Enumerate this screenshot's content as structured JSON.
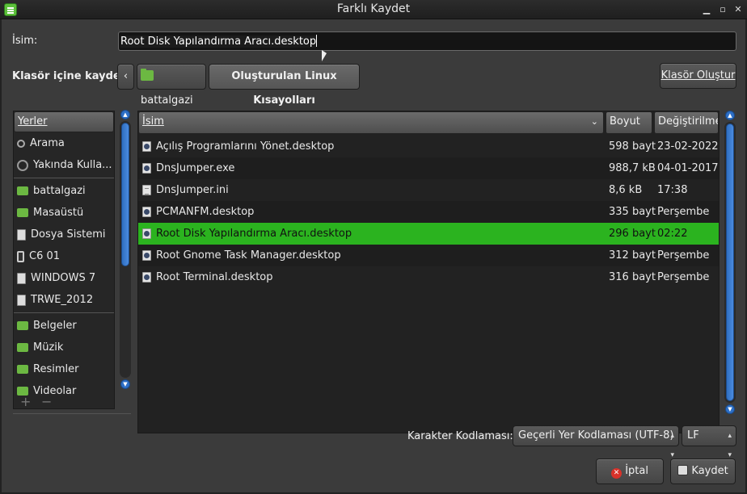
{
  "window": {
    "title": "Farklı Kaydet"
  },
  "name_row": {
    "label": "İsim:",
    "value": "Root Disk Yapılandırma Aracı.desktop"
  },
  "folder_row": {
    "label": "Klasör içine kaydet:",
    "back_glyph": "‹",
    "crumbs": [
      "battalgazi",
      "Oluşturulan Linux Kısayolları"
    ],
    "create_folder": "Klasör Oluştur"
  },
  "places": {
    "header": "Yerler",
    "items": [
      {
        "label": "Arama",
        "icon": "search-icon"
      },
      {
        "label": "Yakında Kulla...",
        "icon": "clock-icon"
      },
      {
        "label": "battalgazi",
        "icon": "home-folder-icon"
      },
      {
        "label": "Masaüstü",
        "icon": "desktop-folder-icon"
      },
      {
        "label": "Dosya Sistemi",
        "icon": "drive-icon"
      },
      {
        "label": "C6 01",
        "icon": "phone-icon"
      },
      {
        "label": "WINDOWS 7",
        "icon": "drive-icon"
      },
      {
        "label": "TRWE_2012",
        "icon": "drive-icon"
      },
      {
        "label": "Belgeler",
        "icon": "folder-icon"
      },
      {
        "label": "Müzik",
        "icon": "music-folder-icon"
      },
      {
        "label": "Resimler",
        "icon": "pictures-folder-icon"
      },
      {
        "label": "Videolar",
        "icon": "folder-icon"
      }
    ],
    "add_glyph": "+",
    "remove_glyph": "−"
  },
  "files": {
    "columns": {
      "name": "İsim",
      "size": "Boyut",
      "modified": "Değiştirilme"
    },
    "rows": [
      {
        "name": "Açılış Programlarını Yönet.desktop",
        "size": "598 bayt",
        "modified": "23-02-2022",
        "icon": "desktop-file-icon"
      },
      {
        "name": "DnsJumper.exe",
        "size": "988,7 kB",
        "modified": "04-01-2017",
        "icon": "executable-icon"
      },
      {
        "name": "DnsJumper.ini",
        "size": "8,6 kB",
        "modified": "17:38",
        "icon": "text-file-icon"
      },
      {
        "name": "PCMANFM.desktop",
        "size": "335 bayt",
        "modified": "Perşembe",
        "icon": "desktop-file-icon"
      },
      {
        "name": "Root Disk Yapılandırma Aracı.desktop",
        "size": "296 bayt",
        "modified": "02:22",
        "icon": "desktop-file-icon",
        "selected": true
      },
      {
        "name": "Root Gnome Task Manager.desktop",
        "size": "312 bayt",
        "modified": "Perşembe",
        "icon": "desktop-file-icon"
      },
      {
        "name": "Root Terminal.desktop",
        "size": "316 bayt",
        "modified": "Perşembe",
        "icon": "desktop-file-icon"
      }
    ]
  },
  "encoding": {
    "label": "Karakter Kodlaması:",
    "value": "Geçerli Yer Kodlaması (UTF-8)",
    "line_ending": "LF"
  },
  "actions": {
    "cancel": "İptal",
    "save": "Kaydet"
  },
  "colors": {
    "selection": "#2bb31f",
    "accent_scroll": "#2f6fc0",
    "folder": "#6cb842"
  }
}
